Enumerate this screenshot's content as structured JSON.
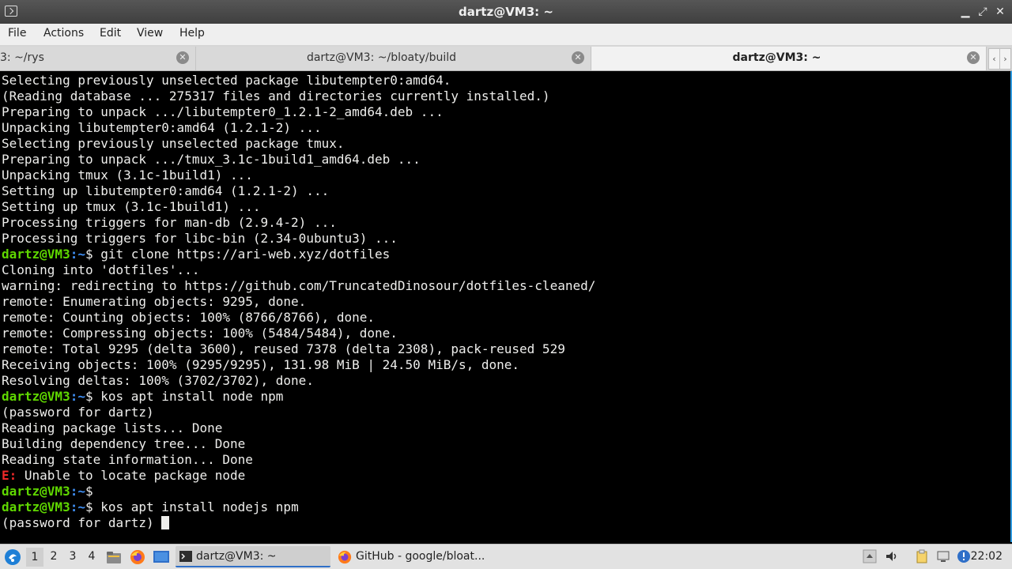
{
  "window": {
    "title": "dartz@VM3: ~",
    "controls": [
      "minimize-icon",
      "maximize-icon",
      "close-icon"
    ]
  },
  "menu": [
    "File",
    "Actions",
    "Edit",
    "View",
    "Help"
  ],
  "tabs": [
    {
      "label": "3: ~/rys",
      "active": false
    },
    {
      "label": "dartz@VM3: ~/bloaty/build",
      "active": false
    },
    {
      "label": "dartz@VM3: ~",
      "active": true
    }
  ],
  "terminal": {
    "prompt_user": "dartz@VM3",
    "prompt_path": ":~",
    "prompt_symbol": "$",
    "lines": [
      {
        "type": "out",
        "text": "Selecting previously unselected package libutempter0:amd64."
      },
      {
        "type": "out",
        "text": "(Reading database ... 275317 files and directories currently installed.)"
      },
      {
        "type": "out",
        "text": "Preparing to unpack .../libutempter0_1.2.1-2_amd64.deb ..."
      },
      {
        "type": "out",
        "text": "Unpacking libutempter0:amd64 (1.2.1-2) ..."
      },
      {
        "type": "out",
        "text": "Selecting previously unselected package tmux."
      },
      {
        "type": "out",
        "text": "Preparing to unpack .../tmux_3.1c-1build1_amd64.deb ..."
      },
      {
        "type": "out",
        "text": "Unpacking tmux (3.1c-1build1) ..."
      },
      {
        "type": "out",
        "text": "Setting up libutempter0:amd64 (1.2.1-2) ..."
      },
      {
        "type": "out",
        "text": "Setting up tmux (3.1c-1build1) ..."
      },
      {
        "type": "out",
        "text": "Processing triggers for man-db (2.9.4-2) ..."
      },
      {
        "type": "out",
        "text": "Processing triggers for libc-bin (2.34-0ubuntu3) ..."
      },
      {
        "type": "cmd",
        "text": " git clone https://ari-web.xyz/dotfiles"
      },
      {
        "type": "out",
        "text": "Cloning into 'dotfiles'..."
      },
      {
        "type": "out",
        "text": "warning: redirecting to https://github.com/TruncatedDinosour/dotfiles-cleaned/"
      },
      {
        "type": "out",
        "text": "remote: Enumerating objects: 9295, done."
      },
      {
        "type": "out",
        "text": "remote: Counting objects: 100% (8766/8766), done."
      },
      {
        "type": "out",
        "text": "remote: Compressing objects: 100% (5484/5484), done."
      },
      {
        "type": "out",
        "text": "remote: Total 9295 (delta 3600), reused 7378 (delta 2308), pack-reused 529"
      },
      {
        "type": "out",
        "text": "Receiving objects: 100% (9295/9295), 131.98 MiB | 24.50 MiB/s, done."
      },
      {
        "type": "out",
        "text": "Resolving deltas: 100% (3702/3702), done."
      },
      {
        "type": "cmd",
        "text": " kos apt install node npm"
      },
      {
        "type": "out",
        "text": "(password for dartz)"
      },
      {
        "type": "out",
        "text": "Reading package lists... Done"
      },
      {
        "type": "out",
        "text": "Building dependency tree... Done"
      },
      {
        "type": "out",
        "text": "Reading state information... Done"
      },
      {
        "type": "err",
        "prefix": "E:",
        "text": " Unable to locate package node"
      },
      {
        "type": "cmd",
        "text": ""
      },
      {
        "type": "cmd",
        "text": " kos apt install nodejs npm"
      },
      {
        "type": "out",
        "text": "(password for dartz) ",
        "cursor": true
      }
    ]
  },
  "taskbar": {
    "workspaces": [
      "1",
      "2",
      "3",
      "4"
    ],
    "active_workspace": "1",
    "tasks": [
      {
        "label": "dartz@VM3: ~",
        "icon": "terminal-icon",
        "active": true
      },
      {
        "label": "GitHub - google/bloat...",
        "icon": "firefox-icon",
        "active": false
      }
    ],
    "clock": "22:02",
    "colors": {
      "accent": "#2f9be0",
      "prompt_user": "#5fd700",
      "prompt_path": "#3f8ff5",
      "error": "#ef2929"
    }
  }
}
